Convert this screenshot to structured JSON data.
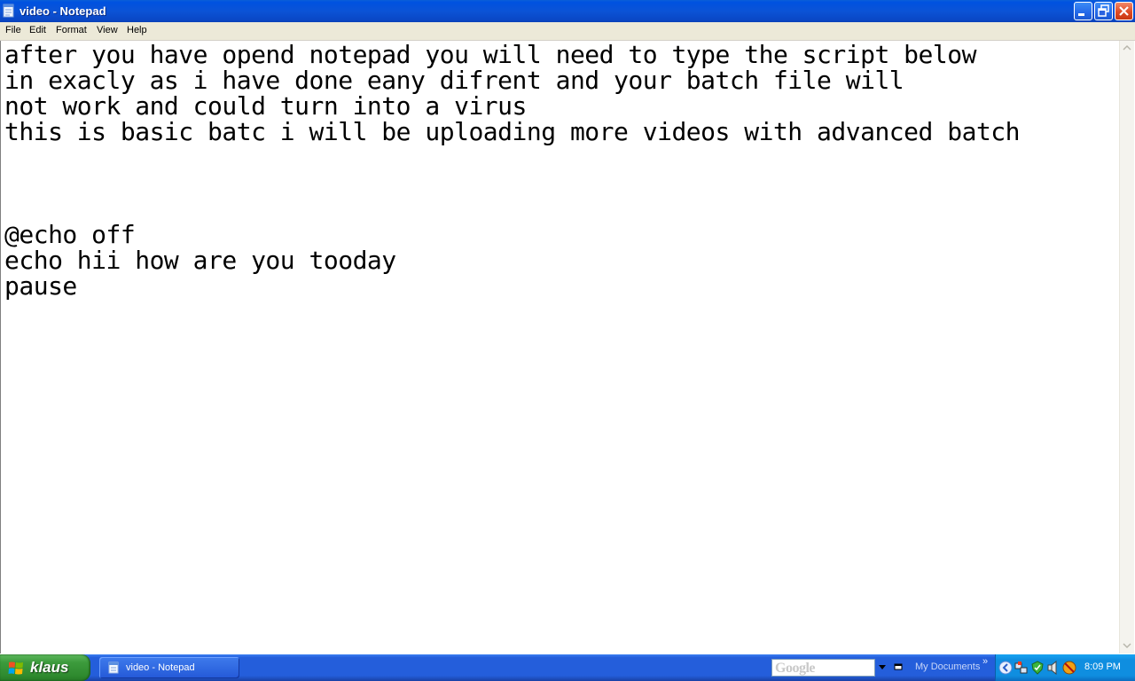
{
  "window": {
    "title": "video - Notepad"
  },
  "menu": {
    "file": "File",
    "edit": "Edit",
    "format": "Format",
    "view": "View",
    "help": "Help"
  },
  "editor": {
    "content": "after you have opend notepad you will need to type the script below\nin exacly as i have done eany difrent and your batch file will\nnot work and could turn into a virus\nthis is basic batc i will be uploading more videos with advanced batch\n\n\n\n@echo off\necho hii how are you tooday\npause"
  },
  "taskbar": {
    "start_label": "klaus",
    "task_label": "video - Notepad",
    "google_placeholder": "Google",
    "address_label": "My Documents",
    "chevron": "»",
    "clock": "8:09 PM"
  },
  "colors": {
    "titlebar": "#0b53d6",
    "taskbar": "#245edb",
    "start": "#3c9b3c",
    "tray": "#0f8ee0",
    "menubar": "#ece9d8"
  }
}
